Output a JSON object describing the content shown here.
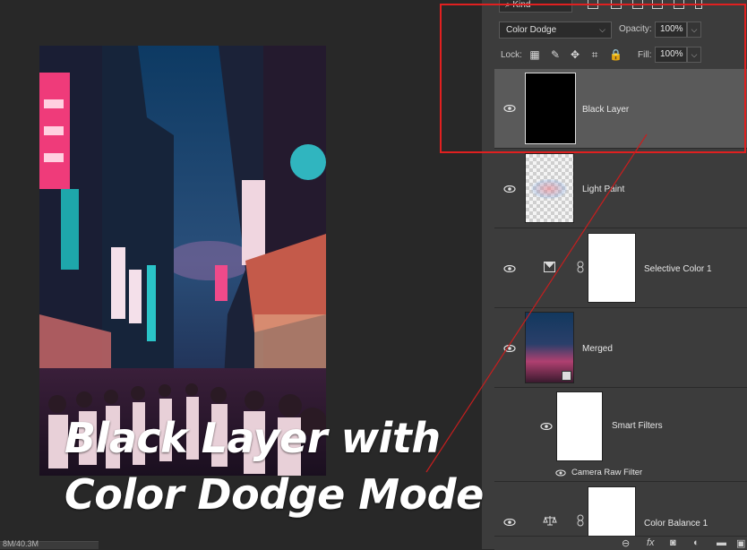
{
  "canvas": {
    "status_text": "8M/40.3M"
  },
  "caption": {
    "line1": "Black Layer with",
    "line2": "Color Dodge Mode"
  },
  "layers_panel": {
    "filter": {
      "kind_label": "Kind"
    },
    "blend_mode": "Color Dodge",
    "opacity_label": "Opacity:",
    "opacity_value": "100%",
    "lock_label": "Lock:",
    "fill_label": "Fill:",
    "fill_value": "100%",
    "layers": [
      {
        "name": "Black Layer",
        "selected": true
      },
      {
        "name": "Light Paint",
        "selected": false
      },
      {
        "name": "Selective Color 1",
        "selected": false
      },
      {
        "name": "Merged",
        "selected": false
      },
      {
        "name": "Smart Filters",
        "selected": false
      },
      {
        "name": "Camera Raw Filter",
        "selected": false
      },
      {
        "name": "Color Balance 1",
        "selected": false
      }
    ],
    "bottom_icons": [
      "link-icon",
      "fx-icon",
      "mask-icon",
      "adjustment-icon",
      "group-icon",
      "new-layer-icon"
    ]
  },
  "colors": {
    "highlight_red": "#e02020",
    "panel_bg": "#3c3c3c",
    "selected_row": "#5a5a5a"
  }
}
